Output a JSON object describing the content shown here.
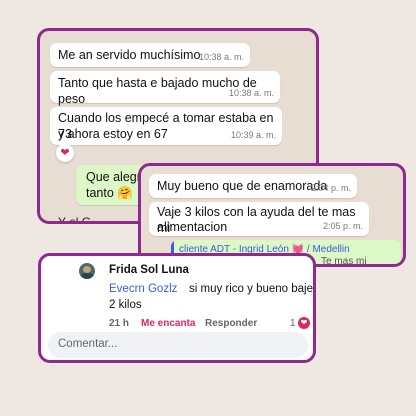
{
  "chat1": {
    "messages": [
      {
        "text": "Me an servido muchísimo",
        "time": "10:38 a. m."
      },
      {
        "text": "Tanto que hasta e bajado mucho de peso",
        "time": "10:38 a. m."
      },
      {
        "text_line1": "Cuando los empecé a tomar estaba en 73",
        "text_line2": "y ahora estoy en 67",
        "time": "10:39 a. m."
      }
    ],
    "reaction": "❤",
    "outgoing": {
      "line1": "Que alegría",
      "line2": "tanto",
      "emoji": "🤗"
    },
    "cut_text": "Y el G..."
  },
  "chat2": {
    "messages": [
      {
        "text": "Muy bueno que de enamorada",
        "time": "2:04 p. m."
      },
      {
        "text_line1": "Vaje 3 kilos con la ayuda del te mas mi",
        "text_line2": "alimentacion",
        "time": "2:05 p. m."
      }
    ],
    "reply_preview": {
      "name": "cliente ADT - Ingrid León 💓 / Medellin",
      "snippet": "Te mas mi"
    }
  },
  "comment": {
    "author": "Frida Sol Luna",
    "mention": "Evecrn Gozlz",
    "text_line1": "si muy rico y bueno baje",
    "text_line2": "2 kilos",
    "age": "21 h",
    "like_label": "Me encanta",
    "reply_label": "Responder",
    "reaction_count": "1",
    "input_placeholder": "Comentar..."
  },
  "colors": {
    "frame": "#8e2a8f",
    "wa_bg": "#e7ddd3",
    "outgoing_bubble": "#dcf8c6",
    "like_red": "#e0245e",
    "mention_blue": "#3b5bdb"
  }
}
